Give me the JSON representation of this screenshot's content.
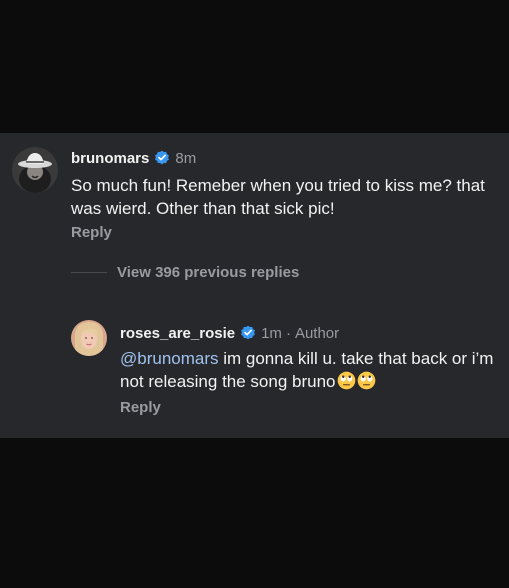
{
  "comment": {
    "username": "brunomars",
    "time": "8m",
    "text": "So much fun! Remeber when you tried to kiss me? that was wierd. Other than that sick pic!",
    "reply_label": "Reply",
    "avatar_icon": "cowboy-hat-avatar",
    "verified_icon": "verified-badge-icon"
  },
  "view_replies_label": "View 396 previous replies",
  "reply": {
    "username": "roses_are_rosie",
    "time": "1m",
    "separator": "·",
    "author_label": "Author",
    "mention": "@brunomars",
    "text": " im gonna kill u. take that back or i’m not releasing the song bruno",
    "emojis": [
      "face-with-rolling-eyes",
      "face-with-rolling-eyes"
    ],
    "reply_label": "Reply",
    "avatar_icon": "blonde-woman-avatar",
    "verified_icon": "verified-badge-icon"
  },
  "colors": {
    "panel": "#27282c",
    "background": "#0c0c0d",
    "text": "#f2f2f2",
    "muted": "#9a9ba0",
    "mention": "#9fc2ee",
    "verified": "#3897f0"
  }
}
